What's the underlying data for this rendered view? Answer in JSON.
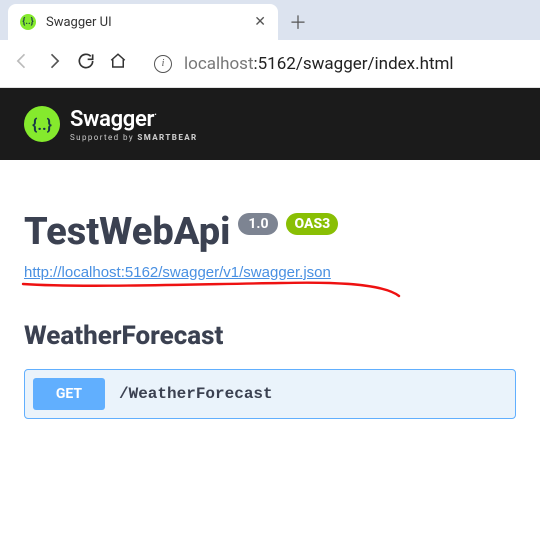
{
  "browser": {
    "tab_title": "Swagger UI",
    "tab_favicon_glyph": "{..}",
    "new_tab_glyph": "＋",
    "close_glyph": "✕",
    "url_host": "localhost",
    "url_path": ":5162/swagger/index.html",
    "info_glyph": "i"
  },
  "header": {
    "logo_glyph": "{..}",
    "brand": "Swagger",
    "supported_prefix": "Supported by ",
    "supported_brand": "SMARTBEAR"
  },
  "info": {
    "title": "TestWebApi",
    "version": "1.0",
    "oas": "OAS3",
    "json_url": "http://localhost:5162/swagger/v1/swagger.json"
  },
  "section": {
    "name": "WeatherForecast"
  },
  "operation": {
    "method": "GET",
    "path": "/WeatherForecast"
  }
}
